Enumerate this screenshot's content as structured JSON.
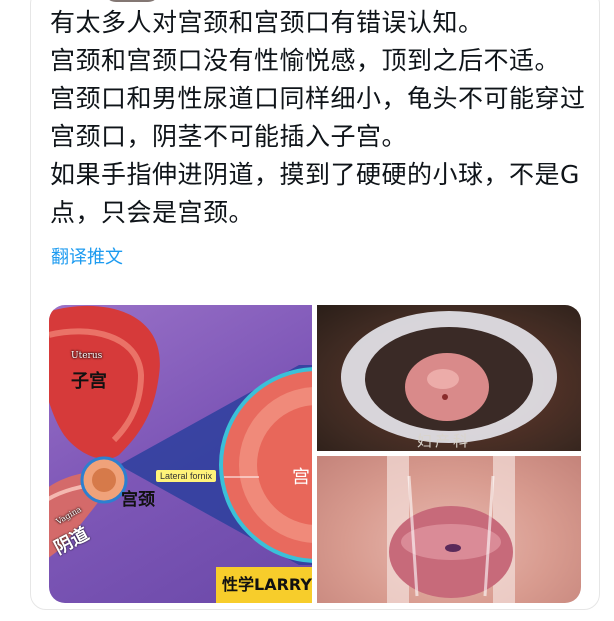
{
  "tweet": {
    "lines": [
      "有太多人对宫颈和宫颈口有错误认知。",
      "宫颈和宫颈口没有性愉悦感，顶到之后不适。",
      "宫颈口和男性尿道口同样细小，龟头不可能穿过宫颈口，阴茎不可能插入子宫。",
      "如果手指伸进阴道，摸到了硬硬的小球，不是G点，只会是宫颈。"
    ],
    "translate_label": "翻译推文"
  },
  "media": {
    "diagram": {
      "uterus_en": "Uterus",
      "uterus_zh": "子宫",
      "cervix_zh": "宫颈",
      "lateral_fornix_en": "Lateral fornix",
      "vagina_en": "Vagina",
      "vagina_zh": "阴道",
      "cervix_partial_zh": "宫",
      "watermark": "性学LARRY老"
    },
    "photo_top_mark": "妇产科"
  },
  "colors": {
    "link": "#1d9bf0",
    "text": "#0f1419",
    "diagram_bg": "#7f58b8",
    "uterus": "#d63a3a",
    "watermark_bg": "#f7cd2b"
  }
}
